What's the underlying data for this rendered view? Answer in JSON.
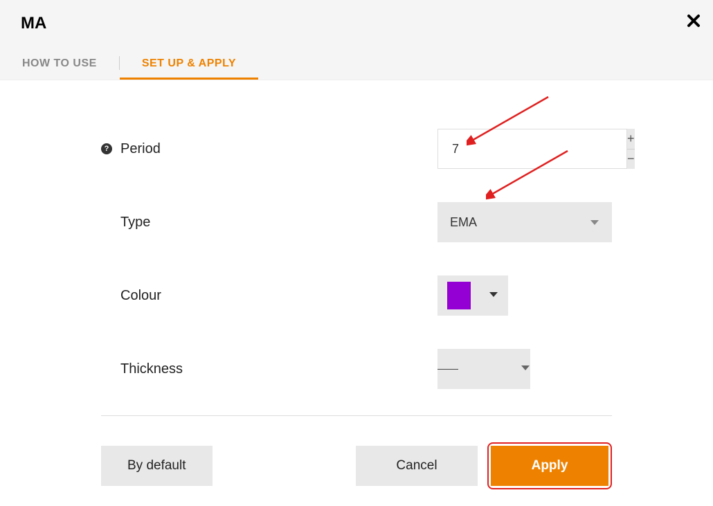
{
  "header": {
    "title": "MA",
    "close_icon": "close-icon"
  },
  "tabs": {
    "items": [
      {
        "label": "HOW TO USE",
        "active": false
      },
      {
        "label": "SET UP & APPLY",
        "active": true
      }
    ]
  },
  "form": {
    "period": {
      "label": "Period",
      "value": "7",
      "help": "?"
    },
    "type": {
      "label": "Type",
      "value": "EMA"
    },
    "colour": {
      "label": "Colour",
      "value": "#9400d3"
    },
    "thickness": {
      "label": "Thickness",
      "value": "thin"
    }
  },
  "buttons": {
    "default": "By default",
    "cancel": "Cancel",
    "apply": "Apply"
  }
}
